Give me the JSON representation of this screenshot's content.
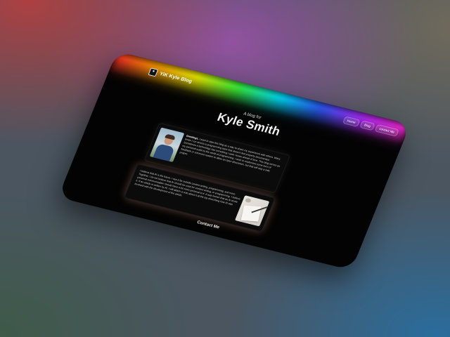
{
  "nav": {
    "logo_text": "YiK Kyle Blog",
    "links": [
      "Home",
      "Blog",
      "contact Me"
    ]
  },
  "hero": {
    "subtitle": "A blog for",
    "title": "Kyle Smith"
  },
  "intro_card": {
    "lead": "Greetings,",
    "text": " I want to start this blog as a way to share my experience with others. Many times I run across a programming topic that doesn't feel properly documented. Sometimes a technology has something I wish I knew ahead of time. This blog serves as my personal outlet to the world of programming. I wish to implement some form of feedback or comment system to allow an open discussion, but that will stay a side project."
  },
  "ai_card": {
    "text": "I believe that AI is the future. I see it far outside content writing, programming, and more. Together, I do not believe that AI should be used for content writing, or programming. I believe personal communication should have a lot more personal to it. It was known that an AI wrote it. If an article is written by AI, I will attach a note about it at the top describing how AI was involved with the development of the article."
  },
  "footer": {
    "contact_label": "Contact Me"
  },
  "colors": {
    "window_bg": "#030303",
    "text": "#cfcfcf",
    "title": "#f2f2f2"
  }
}
